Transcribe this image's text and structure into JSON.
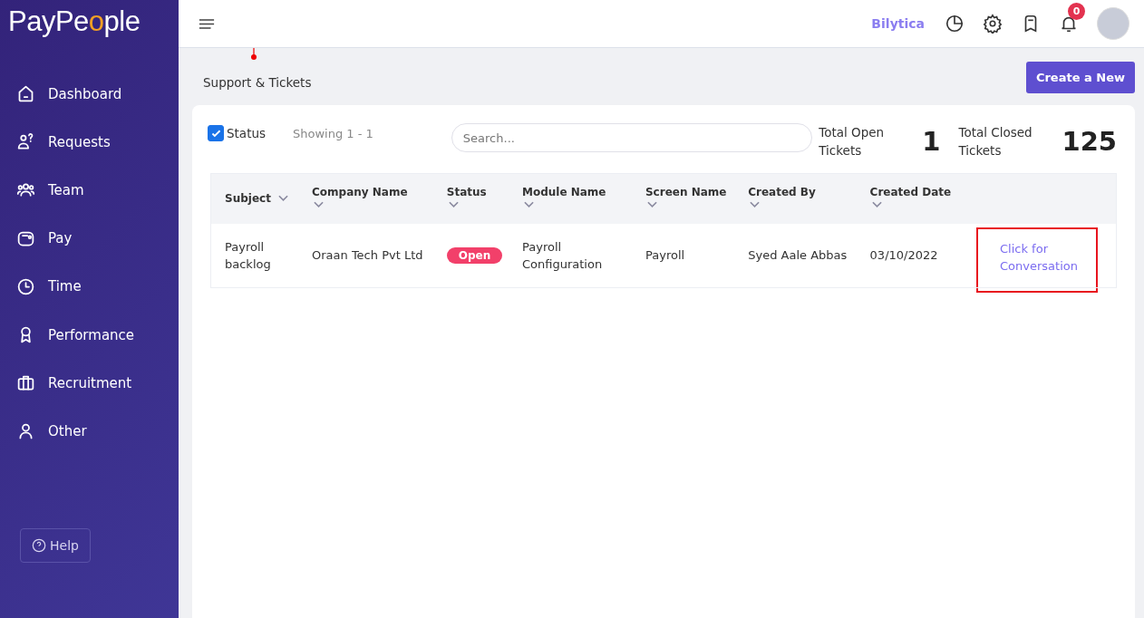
{
  "logo": {
    "before": "PayPe",
    "accent": "o",
    "after": "ple"
  },
  "sidebar": {
    "items": [
      {
        "label": "Dashboard"
      },
      {
        "label": "Requests"
      },
      {
        "label": "Team"
      },
      {
        "label": "Pay"
      },
      {
        "label": "Time"
      },
      {
        "label": "Performance"
      },
      {
        "label": "Recruitment"
      },
      {
        "label": "Other"
      }
    ],
    "help": "Help"
  },
  "header": {
    "company": "Bilytica",
    "notifications": "0"
  },
  "page": {
    "title": "Support & Tickets",
    "create_button": "Create a New"
  },
  "filters": {
    "status": {
      "label": "Status",
      "checked": true
    },
    "showing": "Showing 1 - 1",
    "search": {
      "placeholder": "Search..."
    }
  },
  "totals": [
    {
      "label": "Total Open Tickets",
      "value": "1"
    },
    {
      "label": "Total Closed Tickets",
      "value": "125"
    }
  ],
  "table": {
    "columns": [
      "Subject",
      "Company Name",
      "Status",
      "Module Name",
      "Screen Name",
      "Created By",
      "Created Date"
    ],
    "rows": [
      {
        "subject": "Payroll backlog",
        "company": "Oraan Tech Pvt Ltd",
        "status": "Open",
        "module": "Payroll Configuration",
        "screen": "Payroll",
        "created_by": "Syed Aale Abbas",
        "created_date": "03/10/2022",
        "action": "Click for Conversation"
      }
    ]
  }
}
